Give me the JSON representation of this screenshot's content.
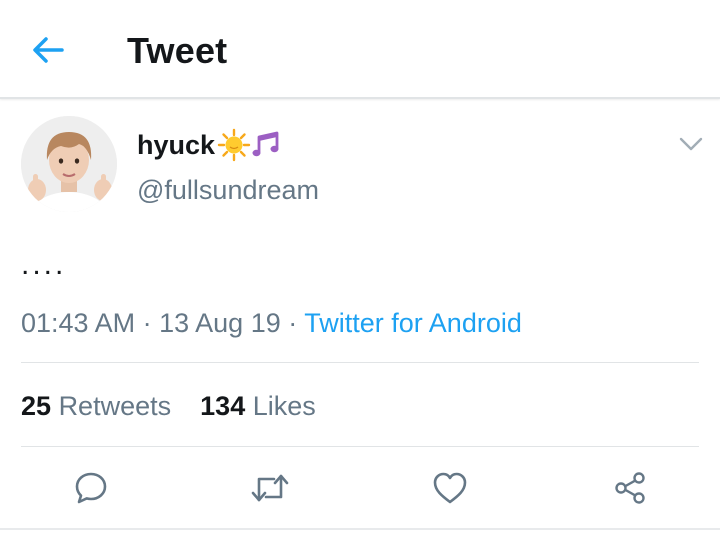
{
  "header": {
    "title": "Tweet",
    "back_icon": "arrow-left-icon",
    "accent": "#1da1f2"
  },
  "tweet": {
    "author": {
      "display_name": "hyuck",
      "name_emojis": [
        "sun-emoji",
        "musical-notes-emoji"
      ],
      "handle": "@fullsundream",
      "avatar": "profile-photo"
    },
    "text": "....",
    "time": "01:43 AM",
    "separator": "·",
    "date": "13 Aug 19",
    "source": "Twitter for Android"
  },
  "stats": {
    "retweets_count": "25",
    "retweets_label": "Retweets",
    "likes_count": "134",
    "likes_label": "Likes"
  },
  "actions": [
    "reply-icon",
    "retweet-icon",
    "like-icon",
    "share-icon"
  ],
  "colors": {
    "text_primary": "#14171a",
    "text_secondary": "#657786",
    "link": "#1da1f2",
    "divider": "#e1e4e6",
    "icon": "#657786"
  }
}
